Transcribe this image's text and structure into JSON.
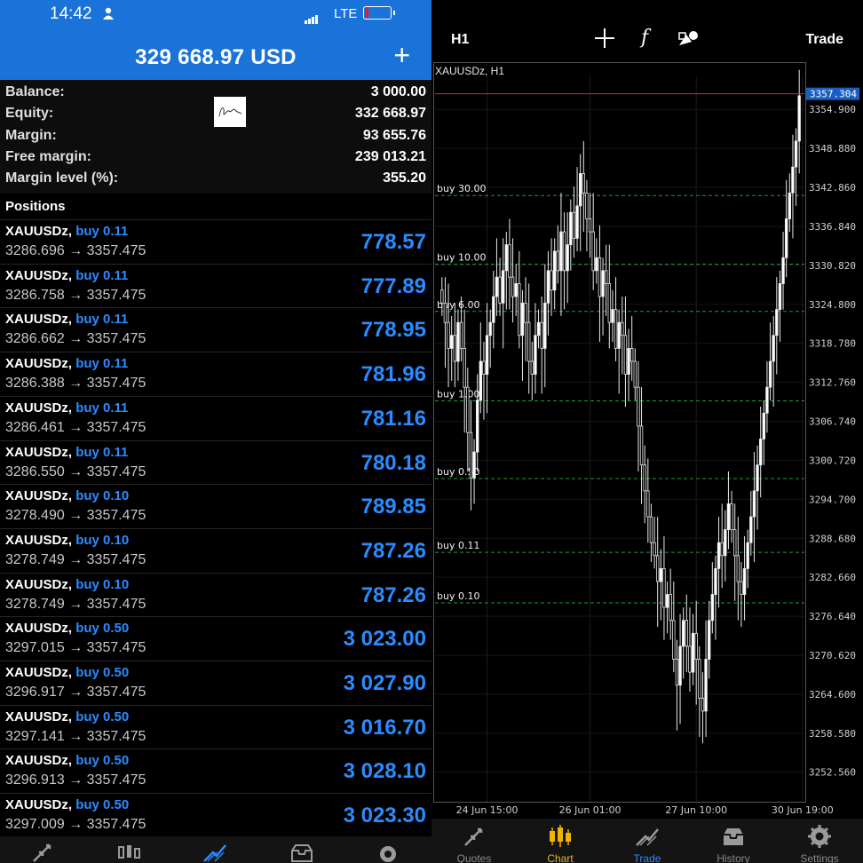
{
  "left": {
    "status": {
      "time": "14:42",
      "network": "LTE"
    },
    "header": {
      "total": "329 668.97 USD",
      "plus": "+"
    },
    "account": [
      {
        "key": "Balance:",
        "value": "3 000.00"
      },
      {
        "key": "Equity:",
        "value": "332 668.97"
      },
      {
        "key": "Margin:",
        "value": "93 655.76"
      },
      {
        "key": "Free margin:",
        "value": "239 013.21"
      },
      {
        "key": "Margin level (%):",
        "value": "355.20"
      }
    ],
    "positions_title": "Positions",
    "positions": [
      {
        "symbol": "XAUUSDz,",
        "side": "buy 0.11",
        "open": "3286.696",
        "arrow": "→",
        "current": "3357.475",
        "profit": "778.57"
      },
      {
        "symbol": "XAUUSDz,",
        "side": "buy 0.11",
        "open": "3286.758",
        "arrow": "→",
        "current": "3357.475",
        "profit": "777.89"
      },
      {
        "symbol": "XAUUSDz,",
        "side": "buy 0.11",
        "open": "3286.662",
        "arrow": "→",
        "current": "3357.475",
        "profit": "778.95"
      },
      {
        "symbol": "XAUUSDz,",
        "side": "buy 0.11",
        "open": "3286.388",
        "arrow": "→",
        "current": "3357.475",
        "profit": "781.96"
      },
      {
        "symbol": "XAUUSDz,",
        "side": "buy 0.11",
        "open": "3286.461",
        "arrow": "→",
        "current": "3357.475",
        "profit": "781.16"
      },
      {
        "symbol": "XAUUSDz,",
        "side": "buy 0.11",
        "open": "3286.550",
        "arrow": "→",
        "current": "3357.475",
        "profit": "780.18"
      },
      {
        "symbol": "XAUUSDz,",
        "side": "buy 0.10",
        "open": "3278.490",
        "arrow": "→",
        "current": "3357.475",
        "profit": "789.85"
      },
      {
        "symbol": "XAUUSDz,",
        "side": "buy 0.10",
        "open": "3278.749",
        "arrow": "→",
        "current": "3357.475",
        "profit": "787.26"
      },
      {
        "symbol": "XAUUSDz,",
        "side": "buy 0.10",
        "open": "3278.749",
        "arrow": "→",
        "current": "3357.475",
        "profit": "787.26"
      },
      {
        "symbol": "XAUUSDz,",
        "side": "buy 0.50",
        "open": "3297.015",
        "arrow": "→",
        "current": "3357.475",
        "profit": "3 023.00"
      },
      {
        "symbol": "XAUUSDz,",
        "side": "buy 0.50",
        "open": "3296.917",
        "arrow": "→",
        "current": "3357.475",
        "profit": "3 027.90"
      },
      {
        "symbol": "XAUUSDz,",
        "side": "buy 0.50",
        "open": "3297.141",
        "arrow": "→",
        "current": "3357.475",
        "profit": "3 016.70"
      },
      {
        "symbol": "XAUUSDz,",
        "side": "buy 0.50",
        "open": "3296.913",
        "arrow": "→",
        "current": "3357.475",
        "profit": "3 028.10"
      },
      {
        "symbol": "XAUUSDz,",
        "side": "buy 0.50",
        "open": "3297.009",
        "arrow": "→",
        "current": "3357.475",
        "profit": "3 023.30"
      }
    ],
    "tab_icons": [
      "quotes-icon",
      "chart-icon",
      "trade-icon",
      "history-icon",
      "settings-icon"
    ],
    "colors": {
      "header_bg": "#1a73d9",
      "profit": "#2a8cff"
    }
  },
  "right": {
    "timeframe": "H1",
    "trade_label": "Trade",
    "func_glyph": "f",
    "chart_title": "XAUUSDz, H1",
    "tabs": [
      {
        "label": "Quotes",
        "icon": "quotes-icon",
        "active": false
      },
      {
        "label": "Chart",
        "icon": "chart-icon",
        "active": true
      },
      {
        "label": "Trade",
        "icon": "trade-icon",
        "active": false
      },
      {
        "label": "History",
        "icon": "history-icon",
        "active": false
      },
      {
        "label": "Settings",
        "icon": "settings-icon",
        "active": false
      }
    ],
    "colors": {
      "active_chart": "#f0b400",
      "active_trade": "#2a8cff",
      "level": "#1e9c3a",
      "price_line": "#c0392b"
    }
  },
  "chart_data": {
    "type": "candlestick",
    "symbol": "XAUUSDz, H1",
    "ylim": [
      3248.0,
      3360.0
    ],
    "y_ticks": [
      "3354.900",
      "3348.880",
      "3342.860",
      "3336.840",
      "3330.820",
      "3324.800",
      "3318.780",
      "3312.760",
      "3306.740",
      "3300.720",
      "3294.700",
      "3288.680",
      "3282.660",
      "3276.640",
      "3270.620",
      "3264.600",
      "3258.580",
      "3252.560"
    ],
    "current_price": "3357.304",
    "x_ticks": [
      {
        "label": "24 Jun 15:00",
        "index": 14
      },
      {
        "label": "26 Jun 01:00",
        "index": 46
      },
      {
        "label": "27 Jun 10:00",
        "index": 79
      },
      {
        "label": "30 Jun 19:00",
        "index": 112
      }
    ],
    "order_levels": [
      {
        "label": "buy 30.00",
        "price": 3341.6
      },
      {
        "label": "buy 10.00",
        "price": 3331.0
      },
      {
        "label": "buy 6.00",
        "price": 3323.7
      },
      {
        "label": "buy 1.00",
        "price": 3309.9
      },
      {
        "label": "buy 0.50",
        "price": 3297.9
      },
      {
        "label": "buy 0.11",
        "price": 3286.5
      },
      {
        "label": "buy 0.10",
        "price": 3278.7
      }
    ],
    "closes": [
      3325,
      3322,
      3318,
      3320,
      3316,
      3322,
      3318,
      3312,
      3305,
      3298,
      3302,
      3310,
      3316,
      3314,
      3320,
      3322,
      3326,
      3329,
      3325,
      3330,
      3334,
      3329,
      3326,
      3328,
      3320,
      3325,
      3322,
      3316,
      3314,
      3320,
      3322,
      3318,
      3325,
      3330,
      3327,
      3333,
      3330,
      3336,
      3330,
      3334,
      3339,
      3335,
      3340,
      3345,
      3342,
      3338,
      3336,
      3330,
      3332,
      3326,
      3330,
      3328,
      3322,
      3324,
      3318,
      3322,
      3320,
      3314,
      3318,
      3316,
      3312,
      3306,
      3300,
      3296,
      3292,
      3288,
      3286,
      3282,
      3284,
      3278,
      3280,
      3276,
      3270,
      3266,
      3272,
      3276,
      3272,
      3268,
      3274,
      3270,
      3264,
      3262,
      3270,
      3276,
      3280,
      3284,
      3288,
      3286,
      3290,
      3294,
      3290,
      3286,
      3282,
      3280,
      3284,
      3288,
      3292,
      3296,
      3300,
      3304,
      3308,
      3312,
      3316,
      3320,
      3324,
      3328,
      3332,
      3338,
      3342,
      3346,
      3350,
      3357
    ]
  }
}
